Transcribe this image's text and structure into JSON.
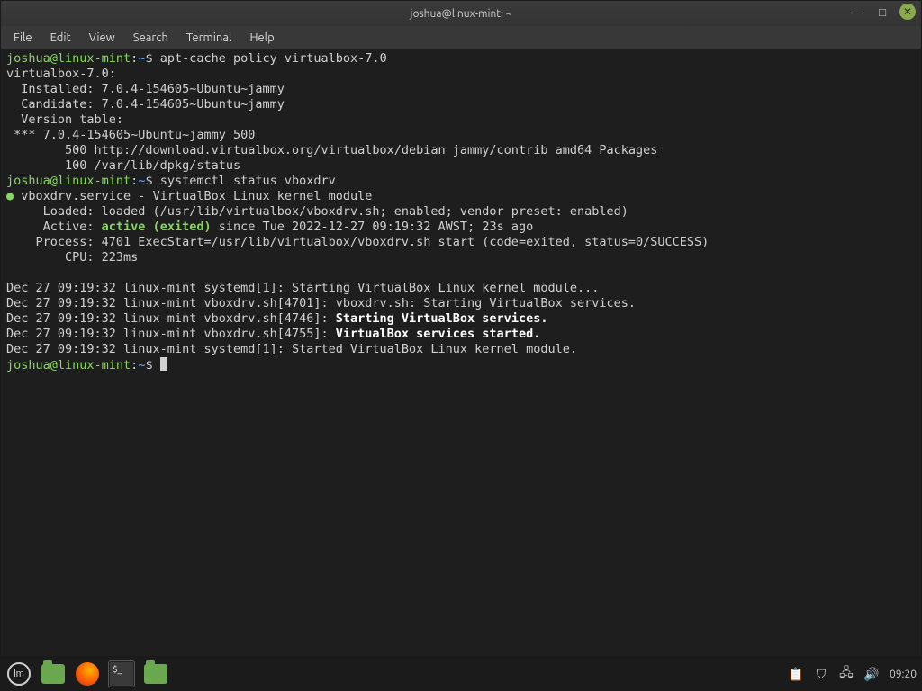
{
  "window": {
    "title": "joshua@linux-mint: ~"
  },
  "menu": {
    "items": [
      "File",
      "Edit",
      "View",
      "Search",
      "Terminal",
      "Help"
    ]
  },
  "prompt": {
    "user_host": "joshua@linux-mint",
    "sep": ":",
    "path": "~",
    "symbol": "$"
  },
  "commands": {
    "cmd1": "apt-cache policy virtualbox-7.0",
    "cmd2": "systemctl status vboxdrv"
  },
  "apt": {
    "header": "virtualbox-7.0:",
    "installed": "  Installed: 7.0.4-154605~Ubuntu~jammy",
    "candidate": "  Candidate: 7.0.4-154605~Ubuntu~jammy",
    "vt_label": "  Version table:",
    "vt_line1": " *** 7.0.4-154605~Ubuntu~jammy 500",
    "vt_line2": "        500 http://download.virtualbox.org/virtualbox/debian jammy/contrib amd64 Packages",
    "vt_line3": "        100 /var/lib/dpkg/status"
  },
  "svc": {
    "dot": "●",
    "header": " vboxdrv.service - VirtualBox Linux kernel module",
    "loaded": "     Loaded: loaded (/usr/lib/virtualbox/vboxdrv.sh; enabled; vendor preset: enabled)",
    "active_label": "     Active: ",
    "active_state": "active (exited)",
    "active_rest": " since Tue 2022-12-27 09:19:32 AWST; 23s ago",
    "process": "    Process: 4701 ExecStart=/usr/lib/virtualbox/vboxdrv.sh start (code=exited, status=0/SUCCESS)",
    "cpu": "        CPU: 223ms"
  },
  "logs": {
    "l1": "Dec 27 09:19:32 linux-mint systemd[1]: Starting VirtualBox Linux kernel module...",
    "l2": "Dec 27 09:19:32 linux-mint vboxdrv.sh[4701]: vboxdrv.sh: Starting VirtualBox services.",
    "l3p": "Dec 27 09:19:32 linux-mint vboxdrv.sh[4746]: ",
    "l3b": "Starting VirtualBox services.",
    "l4p": "Dec 27 09:19:32 linux-mint vboxdrv.sh[4755]: ",
    "l4b": "VirtualBox services started.",
    "l5": "Dec 27 09:19:32 linux-mint systemd[1]: Started VirtualBox Linux kernel module."
  },
  "taskbar": {
    "clock": "09:20",
    "term_glyph": "$_"
  },
  "glyphs": {
    "minimize": "–",
    "maximize": "□",
    "close": "✕",
    "clipboard": "📋",
    "shield": "⛉",
    "network": "🖧",
    "sound": "🔊"
  }
}
